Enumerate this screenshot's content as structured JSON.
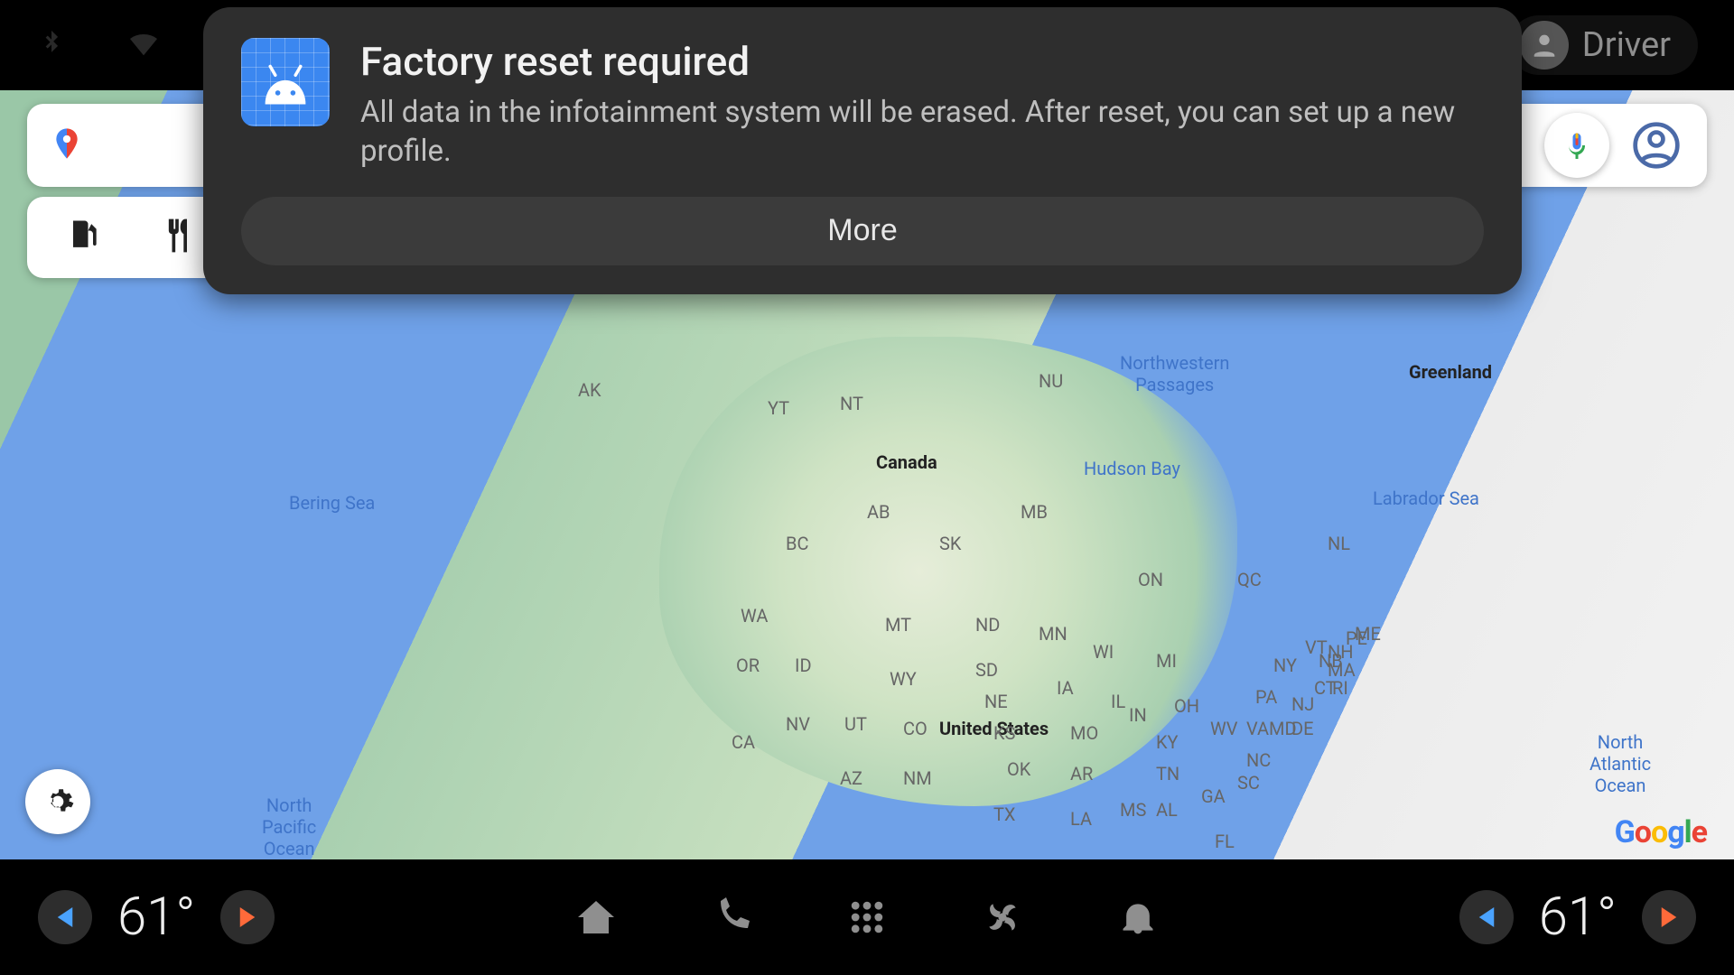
{
  "status": {
    "user_label": "Driver"
  },
  "notification": {
    "title": "Factory reset required",
    "body": "All data in the infotainment system will be erased. After reset, you can set up a new profile.",
    "button": "More"
  },
  "map": {
    "water_labels": {
      "bering": "Bering Sea",
      "hudson": "Hudson Bay",
      "nw_passages": "Northwestern\nPassages",
      "labrador": "Labrador Sea",
      "north_pacific": "North\nPacific\nOcean",
      "north_atlantic": "North\nAtlantic\nOcean"
    },
    "countries": {
      "canada": "Canada",
      "usa": "United States",
      "greenland": "Greenland"
    },
    "states": [
      "AK",
      "YT",
      "NT",
      "NU",
      "BC",
      "AB",
      "SK",
      "MB",
      "ON",
      "QC",
      "NL",
      "PE",
      "NB",
      "WA",
      "OR",
      "CA",
      "ID",
      "NV",
      "UT",
      "AZ",
      "MT",
      "WY",
      "CO",
      "NM",
      "ND",
      "SD",
      "NE",
      "KS",
      "OK",
      "TX",
      "MN",
      "IA",
      "MO",
      "AR",
      "LA",
      "WI",
      "IL",
      "MI",
      "IN",
      "OH",
      "KY",
      "TN",
      "MS",
      "AL",
      "GA",
      "FL",
      "SC",
      "NC",
      "VA",
      "WV",
      "PA",
      "NY",
      "NJ",
      "DE",
      "MD",
      "CT",
      "RI",
      "MA",
      "VT",
      "NH",
      "ME"
    ],
    "attribution": "Google"
  },
  "bottom": {
    "temp_left": "61°",
    "temp_right": "61°"
  }
}
